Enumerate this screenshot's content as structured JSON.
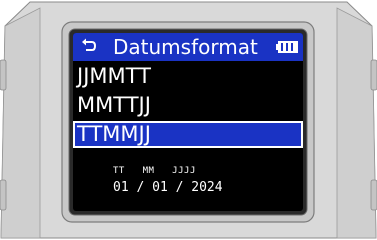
{
  "header": {
    "title": "Datumsformat",
    "back_icon": "back-arrow-icon",
    "battery_icon": "battery-icon"
  },
  "menu": {
    "items": [
      {
        "label": "JJMMTT",
        "selected": false
      },
      {
        "label": "MMTTJJ",
        "selected": false
      },
      {
        "label": "TTMMJJ",
        "selected": true
      }
    ]
  },
  "preview": {
    "labels": "TT   MM   JJJJ",
    "value": "01 / 01 / 2024"
  },
  "colors": {
    "accent": "#1a33c4",
    "screen_bg": "#000000",
    "text": "#ffffff"
  }
}
